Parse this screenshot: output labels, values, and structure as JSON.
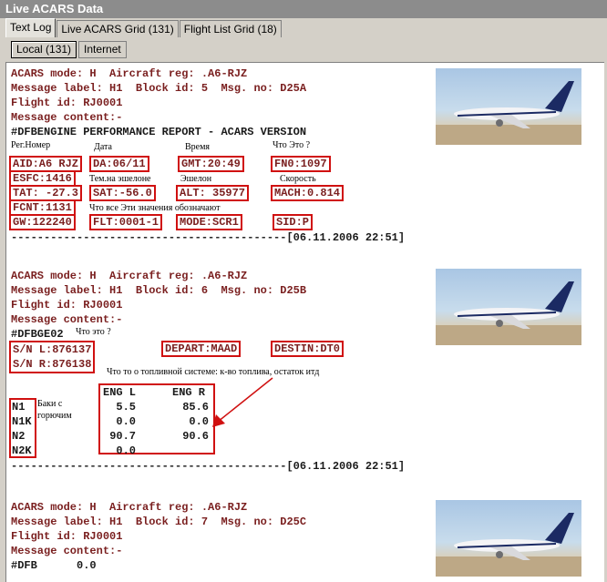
{
  "window": {
    "title": "Live ACARS Data"
  },
  "tabs": [
    "Text Log",
    "Live ACARS Grid (131)",
    "Flight List Grid (18)"
  ],
  "subtabs": [
    "Local (131)",
    "Internet"
  ],
  "entry1": {
    "l1": "ACARS mode: H  Aircraft reg: .A6-RJZ",
    "l2": "Message label: H1  Block id: 5  Msg. no: D25A",
    "l3": "Flight id: RJ0001",
    "l4": "Message content:-",
    "l5": "#DFBENGINE PERFORMANCE REPORT - ACARS VERSION",
    "ru_regnum": "Рег.Номер",
    "ru_date": "Дата",
    "ru_time": "Время",
    "ru_what": "Что Это ?",
    "aid": "AID:A6 RJZ",
    "da": "DA:06/11",
    "gmt": "GMT:20:49",
    "fno": "FN0:1097",
    "esfc": "ESFC:1416",
    "ru_temp": "Тем.на эшелоне",
    "ru_level": "Эшелон",
    "ru_speed": "Скорость",
    "tat": "TAT: -27.3",
    "sat": "SAT:-56.0",
    "alt": "ALT: 35977",
    "mach": "MACH:0.814",
    "fcnt": "FCNT:1131",
    "ru_what2": "Что   все   Эти   значения   обозначают",
    "gw": "GW:122240",
    "flt": "FLT:0001-1",
    "mode": "MODE:SCR1",
    "sid": "SID:P",
    "sep": "------------------------------------------[06.11.2006 22:51]"
  },
  "entry2": {
    "l1": "ACARS mode: H  Aircraft reg: .A6-RJZ",
    "l2": "Message label: H1  Block id: 6  Msg. no: D25B",
    "l3": "Flight id: RJ0001",
    "l4": "Message content:-",
    "l5": "#DFBGE02",
    "ru_what": "Что это ?",
    "sn": "S/N L:876137\nS/N R:876138",
    "depart": "DEPART:MAAD",
    "destin": "DESTIN:DT0",
    "ru_fuel": "Что то о топливной системе: к-во топлива, остаток итд",
    "eng_l": "ENG L",
    "eng_r": "ENG R",
    "rows": [
      "N1",
      "N1K",
      "N2",
      "N2K"
    ],
    "vals_l": [
      "5.5",
      "0.0",
      "90.7",
      "0.0"
    ],
    "vals_r": [
      "85.6",
      "0.0",
      "90.6",
      ""
    ],
    "ru_tanks": "Баки с\nгорючим",
    "sep": "------------------------------------------[06.11.2006 22:51]"
  },
  "entry3": {
    "l1": "ACARS mode: H  Aircraft reg: .A6-RJZ",
    "l2": "Message label: H1  Block id: 7  Msg. no: D25C",
    "l3": "Flight id: RJ0001",
    "l4": "Message content:-",
    "l5": "#DFB      0.0"
  }
}
